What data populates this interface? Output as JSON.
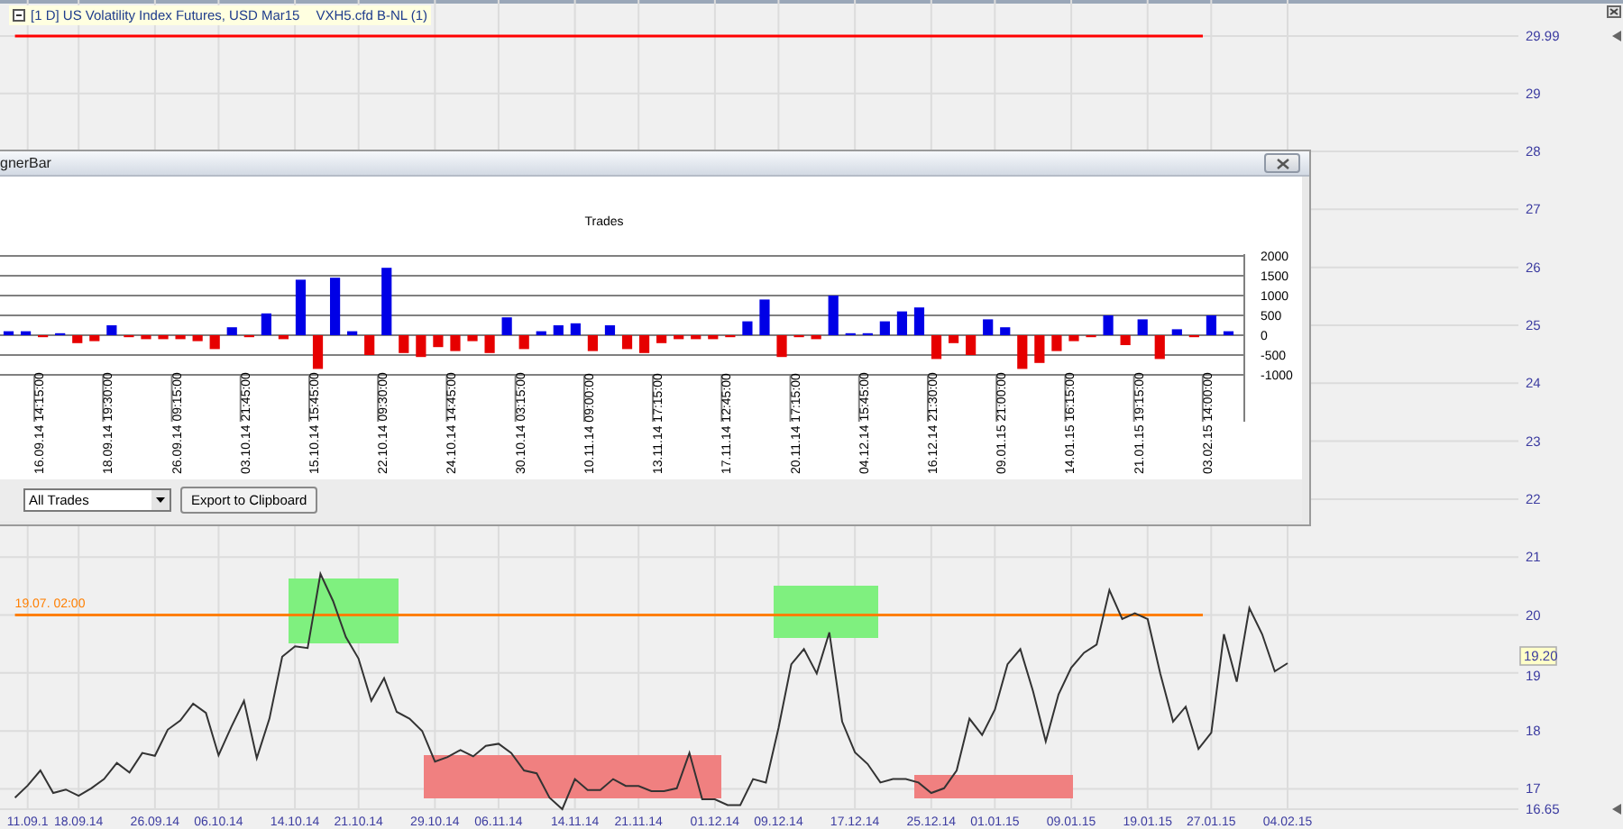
{
  "chart_header": {
    "title": "[1 D] US Volatility Index Futures, USD Mar15",
    "symbol": "VXH5.cfd B-NL (1)"
  },
  "price_chart": {
    "current_price": "19.20",
    "chart_data": {
      "type": "line",
      "grid": true,
      "categories": [
        null,
        "11.09.1",
        null,
        null,
        null,
        "18.09.14",
        null,
        null,
        null,
        null,
        null,
        "26.09.14",
        null,
        null,
        null,
        null,
        "06.10.14",
        null,
        null,
        null,
        null,
        null,
        "14.10.14",
        null,
        null,
        null,
        null,
        "21.10.14",
        null,
        null,
        null,
        null,
        null,
        "29.10.14",
        null,
        null,
        null,
        null,
        "06.11.14",
        null,
        null,
        null,
        null,
        null,
        "14.11.14",
        null,
        null,
        null,
        null,
        "21.11.14",
        null,
        null,
        null,
        null,
        null,
        "01.12.14",
        null,
        null,
        null,
        null,
        "09.12.14",
        null,
        null,
        null,
        null,
        null,
        "17.12.14",
        null,
        null,
        null,
        null,
        null,
        "25.12.14",
        null,
        null,
        null,
        null,
        "01.01.15",
        null,
        null,
        null,
        null,
        null,
        "09.01.15",
        null,
        null,
        null,
        null,
        null,
        "19.01.15",
        null,
        null,
        null,
        null,
        "27.01.15",
        null,
        null,
        null,
        null,
        null,
        "04.02.15"
      ],
      "values": [
        16.85,
        17.06,
        17.32,
        16.93,
        16.99,
        16.88,
        17.01,
        17.17,
        17.45,
        17.28,
        17.62,
        17.57,
        18.02,
        18.18,
        18.47,
        18.31,
        17.58,
        18.07,
        18.52,
        17.53,
        18.21,
        19.28,
        19.46,
        19.43,
        20.71,
        20.24,
        19.62,
        19.25,
        18.52,
        18.91,
        18.33,
        18.21,
        18.0,
        17.47,
        17.55,
        17.67,
        17.56,
        17.74,
        17.78,
        17.62,
        17.32,
        17.27,
        16.85,
        16.65,
        17.17,
        16.98,
        16.98,
        17.17,
        17.05,
        17.05,
        16.96,
        16.96,
        17.01,
        17.62,
        16.82,
        16.82,
        16.72,
        16.72,
        17.17,
        17.11,
        18.05,
        19.15,
        19.41,
        18.99,
        19.7,
        18.16,
        17.63,
        17.43,
        17.11,
        17.17,
        17.17,
        17.11,
        16.93,
        17.01,
        17.32,
        18.21,
        17.93,
        18.37,
        19.15,
        19.41,
        18.68,
        17.82,
        18.63,
        19.09,
        19.35,
        19.49,
        20.43,
        19.93,
        20.03,
        19.93,
        18.99,
        18.16,
        18.42,
        17.69,
        17.97,
        19.67,
        18.85,
        20.12,
        19.67,
        19.03,
        19.17
      ],
      "ylim": [
        16.65,
        29.99
      ],
      "yticks": [
        16.65,
        17,
        18,
        19,
        20,
        21,
        22,
        23,
        24,
        25,
        26,
        27,
        28,
        29,
        29.99
      ],
      "ref_lines": [
        {
          "axis": "y",
          "value": 20,
          "color": "#ff7f00"
        }
      ]
    },
    "line_caption": "19.07. 02:00"
  },
  "dialog": {
    "title": "gnerBar",
    "chart_data": {
      "type": "bar",
      "title": "Trades",
      "grid": true,
      "ylim": [
        -1000,
        2000
      ],
      "yticks": [
        2000,
        1500,
        1000,
        500,
        0,
        -500,
        -1000
      ],
      "categories": [
        null,
        null,
        "16.09.14 14:15:00",
        null,
        null,
        null,
        "18.09.14 19:30:00",
        null,
        null,
        null,
        "26.09.14 09:15:00",
        null,
        null,
        null,
        "03.10.14 21:45:00",
        null,
        null,
        null,
        "15.10.14 15:45:00",
        null,
        null,
        null,
        "22.10.14 09:30:00",
        null,
        null,
        null,
        "24.10.14 14:45:00",
        null,
        null,
        null,
        "30.10.14 03:15:00",
        null,
        null,
        null,
        "10.11.14 09:00:00",
        null,
        null,
        null,
        "13.11.14 17:15:00",
        null,
        null,
        null,
        "17.11.14 12:45:00",
        null,
        null,
        null,
        "20.11.14 17:15:00",
        null,
        null,
        null,
        "04.12.14 15:45:00",
        null,
        null,
        null,
        "16.12.14 21:30:00",
        null,
        null,
        null,
        "09.01.15 21:00:00",
        null,
        null,
        null,
        "14.01.15 16:15:00",
        null,
        null,
        null,
        "21.01.15 19:15:00",
        null,
        null,
        null,
        "03.02.15 14:00:00",
        null
      ],
      "values": [
        100,
        100,
        -50,
        50,
        -200,
        -150,
        250,
        -50,
        -100,
        -100,
        -100,
        -150,
        -350,
        200,
        -50,
        550,
        -100,
        1400,
        -850,
        1450,
        100,
        -500,
        1700,
        -450,
        -550,
        -300,
        -400,
        -150,
        -450,
        450,
        -350,
        100,
        250,
        300,
        -400,
        250,
        -350,
        -450,
        -200,
        -100,
        -100,
        -100,
        -50,
        350,
        900,
        -550,
        -50,
        -100,
        1000,
        50,
        50,
        350,
        600,
        700,
        -600,
        -200,
        -500,
        400,
        200,
        -850,
        -700,
        -400,
        -150,
        -50,
        500,
        -250,
        400,
        -600,
        150,
        -50,
        500,
        100
      ]
    },
    "filter": {
      "value": "All Trades"
    },
    "buttons": [
      "Export to Clipboard"
    ]
  }
}
